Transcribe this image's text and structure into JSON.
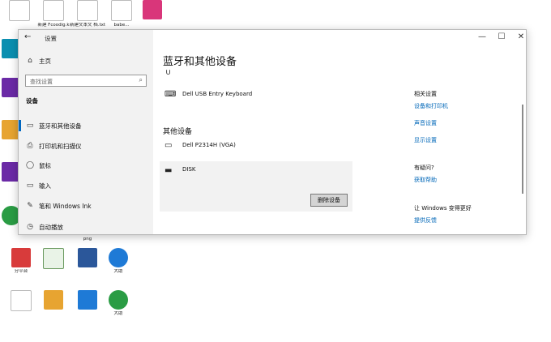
{
  "desktop": {
    "icons": [
      {
        "label": "",
        "type": "doc"
      },
      {
        "label": "新建 Fcoodig.k",
        "type": "doc"
      },
      {
        "label": "新建文本文 档.txt",
        "type": "doc"
      },
      {
        "label": "babe...",
        "type": "doc"
      },
      {
        "label": "",
        "type": "pink"
      },
      {
        "label": "",
        "type": "cyan"
      },
      {
        "label": "",
        "type": "purple"
      },
      {
        "label": "",
        "type": "orange"
      },
      {
        "label": "",
        "type": "purple"
      },
      {
        "label": "",
        "type": "green"
      },
      {
        "label": "",
        "type": "doc"
      },
      {
        "label": "png",
        "type": "doc"
      },
      {
        "label": "",
        "type": "doc"
      },
      {
        "label": "分平台",
        "type": "red"
      },
      {
        "label": "",
        "type": "xls"
      },
      {
        "label": "",
        "type": "word"
      },
      {
        "label": "大助",
        "type": "blue"
      },
      {
        "label": "",
        "type": "doc"
      },
      {
        "label": "",
        "type": "orange"
      },
      {
        "label": "",
        "type": "blue"
      },
      {
        "label": "大助",
        "type": "green"
      }
    ]
  },
  "window": {
    "title": "设置",
    "back_icon": "back-arrow-icon",
    "controls": {
      "minimize": "—",
      "maximize": "☐",
      "close": "✕"
    }
  },
  "sidebar": {
    "home": {
      "icon": "⌂",
      "label": "主页"
    },
    "search_placeholder": "查找设置",
    "section": "设备",
    "items": [
      {
        "icon": "▭",
        "label": "蓝牙和其他设备",
        "name": "bluetooth"
      },
      {
        "icon": "⎙",
        "label": "打印机和扫描仪",
        "name": "printers"
      },
      {
        "icon": "◯",
        "label": "鼠标",
        "name": "mouse"
      },
      {
        "icon": "▭",
        "label": "输入",
        "name": "typing"
      },
      {
        "icon": "✎",
        "label": "笔和 Windows Ink",
        "name": "pen"
      },
      {
        "icon": "◷",
        "label": "自动播放",
        "name": "autoplay"
      }
    ]
  },
  "main": {
    "title": "蓝牙和其他设备",
    "bluetooth_glyph": "∪",
    "keyboard": {
      "icon": "⌨",
      "name": "Dell USB Entry Keyboard"
    },
    "other_header": "其他设备",
    "monitor": {
      "icon": "▭",
      "name": "Dell P2314H (VGA)"
    },
    "disk": {
      "icon": "▬",
      "name": "DISK"
    },
    "remove_button": "删除设备"
  },
  "right": {
    "related_header": "相关设置",
    "related_links": [
      "设备和打印机",
      "声音设置",
      "显示设置"
    ],
    "question_header": "有疑问?",
    "help_link": "获取帮助",
    "better_header": "让 Windows 变得更好",
    "feedback_link": "提供反馈"
  }
}
